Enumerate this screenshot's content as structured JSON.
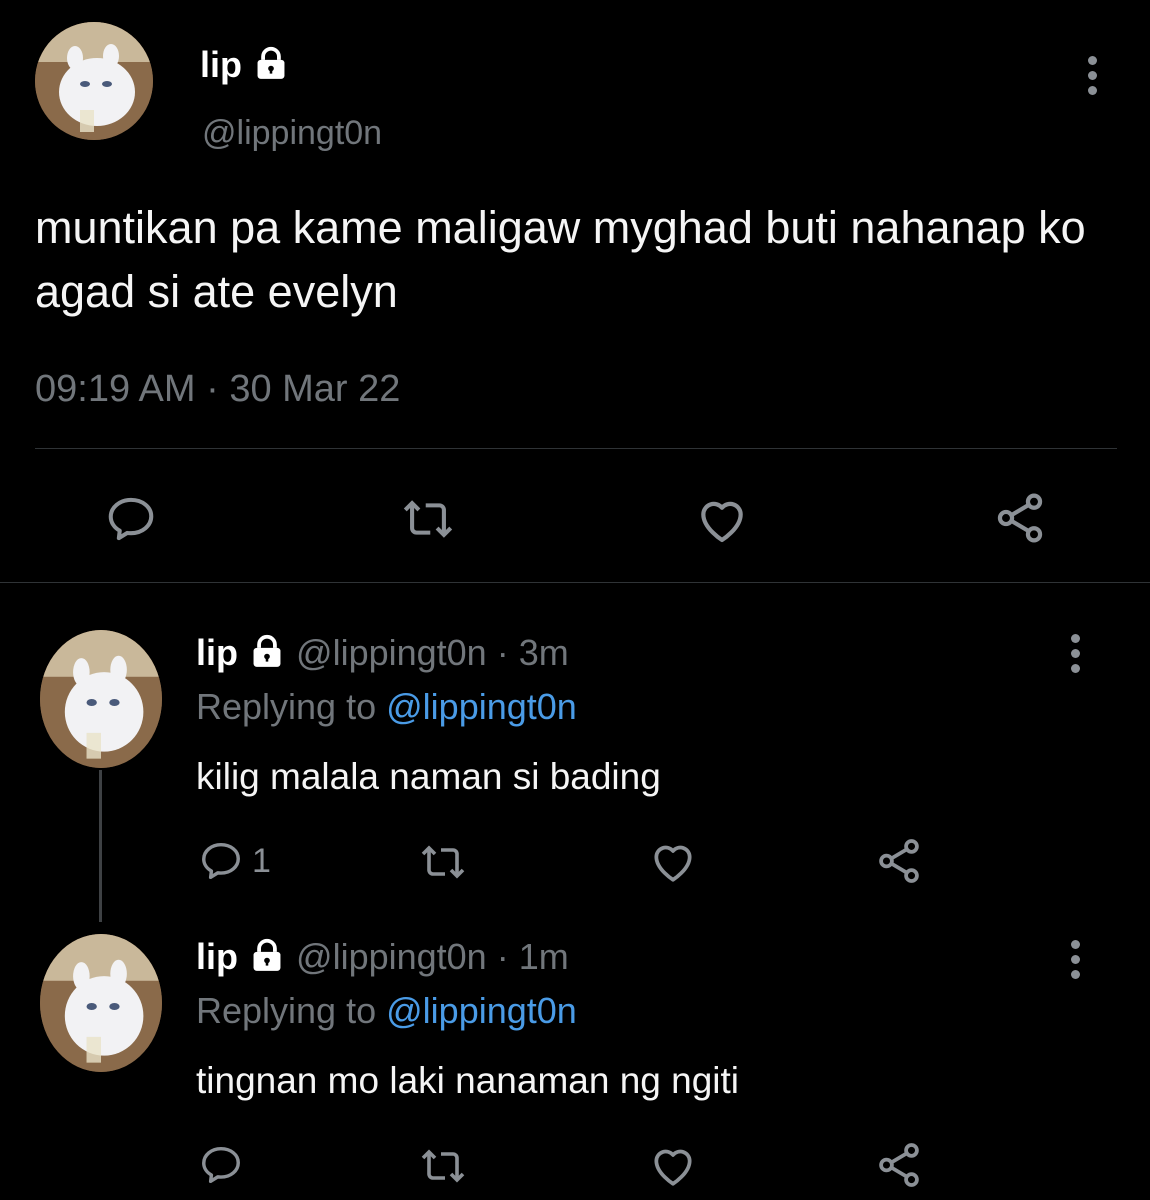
{
  "main_tweet": {
    "display_name": "lip",
    "handle": "@lippingt0n",
    "text": "muntikan pa kame maligaw myghad buti nahanap ko agad si ate evelyn",
    "timestamp": "09:19 AM · 30 Mar 22",
    "actions": [
      "reply-icon",
      "retweet-icon",
      "like-icon",
      "share-icon"
    ]
  },
  "replies": [
    {
      "display_name": "lip",
      "handle": "@lippingt0n",
      "time": "· 3m",
      "replying_label": "Replying to",
      "replying_to": "@lippingt0n",
      "text": "kilig malala naman si bading",
      "reply_count": "1"
    },
    {
      "display_name": "lip",
      "handle": "@lippingt0n",
      "time": "· 1m",
      "replying_label": "Replying to",
      "replying_to": "@lippingt0n",
      "text": "tingnan mo laki nanaman ng ngiti",
      "reply_count": ""
    }
  ],
  "colors": {
    "background": "#000000",
    "text": "#e7e9ea",
    "muted": "#71767b",
    "link": "#4a9be6",
    "divider": "#2f3336"
  }
}
